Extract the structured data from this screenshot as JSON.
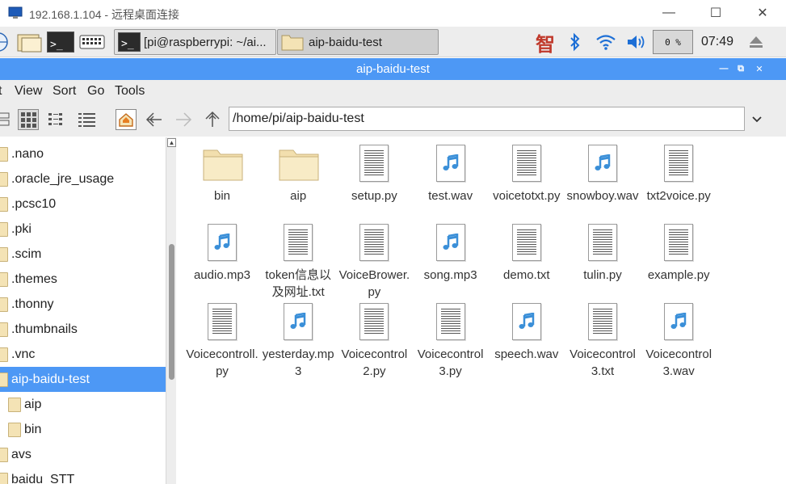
{
  "rdp": {
    "title": "192.168.1.104 - 远程桌面连接"
  },
  "panel": {
    "tasks": [
      {
        "label": "[pi@raspberrypi: ~/ai...",
        "icon": "terminal-icon"
      },
      {
        "label": "aip-baidu-test",
        "icon": "folder-icon"
      }
    ],
    "tray_zhi": "智",
    "cpu": "0 %",
    "clock": "07:49"
  },
  "window": {
    "title": "aip-baidu-test"
  },
  "menu": {
    "items": [
      "t",
      "View",
      "Sort",
      "Go",
      "Tools"
    ]
  },
  "location": {
    "path": "/home/pi/aip-baidu-test"
  },
  "sidebar": {
    "items": [
      {
        "label": ".nano",
        "selected": false,
        "indent": 0
      },
      {
        "label": ".oracle_jre_usage",
        "selected": false,
        "indent": 0
      },
      {
        "label": ".pcsc10",
        "selected": false,
        "indent": 0
      },
      {
        "label": ".pki",
        "selected": false,
        "indent": 0
      },
      {
        "label": ".scim",
        "selected": false,
        "indent": 0
      },
      {
        "label": ".themes",
        "selected": false,
        "indent": 0
      },
      {
        "label": ".thonny",
        "selected": false,
        "indent": 0
      },
      {
        "label": ".thumbnails",
        "selected": false,
        "indent": 0
      },
      {
        "label": ".vnc",
        "selected": false,
        "indent": 0
      },
      {
        "label": "aip-baidu-test",
        "selected": true,
        "indent": 0
      },
      {
        "label": "aip",
        "selected": false,
        "indent": 1
      },
      {
        "label": "bin",
        "selected": false,
        "indent": 1
      },
      {
        "label": "avs",
        "selected": false,
        "indent": 0
      },
      {
        "label": "baidu_STT",
        "selected": false,
        "indent": 0
      }
    ]
  },
  "files": [
    {
      "name": "bin",
      "type": "folder"
    },
    {
      "name": "aip",
      "type": "folder"
    },
    {
      "name": "setup.py",
      "type": "text"
    },
    {
      "name": "test.wav",
      "type": "audio"
    },
    {
      "name": "voicetotxt.py",
      "type": "text"
    },
    {
      "name": "snowboy.wav",
      "type": "audio"
    },
    {
      "name": "txt2voice.py",
      "type": "text"
    },
    {
      "name": "audio.mp3",
      "type": "audio"
    },
    {
      "name": "token信息以及网址.txt",
      "type": "text"
    },
    {
      "name": "VoiceBrower.py",
      "type": "text"
    },
    {
      "name": "song.mp3",
      "type": "audio"
    },
    {
      "name": "demo.txt",
      "type": "text"
    },
    {
      "name": "tulin.py",
      "type": "text"
    },
    {
      "name": "example.py",
      "type": "text"
    },
    {
      "name": "Voicecontroll.py",
      "type": "text"
    },
    {
      "name": "yesterday.mp3",
      "type": "audio"
    },
    {
      "name": "Voicecontrol2.py",
      "type": "text"
    },
    {
      "name": "Voicecontrol3.py",
      "type": "text"
    },
    {
      "name": "speech.wav",
      "type": "audio"
    },
    {
      "name": "Voicecontrol3.txt",
      "type": "text"
    },
    {
      "name": "Voicecontrol3.wav",
      "type": "audio"
    }
  ],
  "colors": {
    "accent": "#4d98f5",
    "folder": "#f4e3b5",
    "audio_note": "#3a8fd8"
  }
}
